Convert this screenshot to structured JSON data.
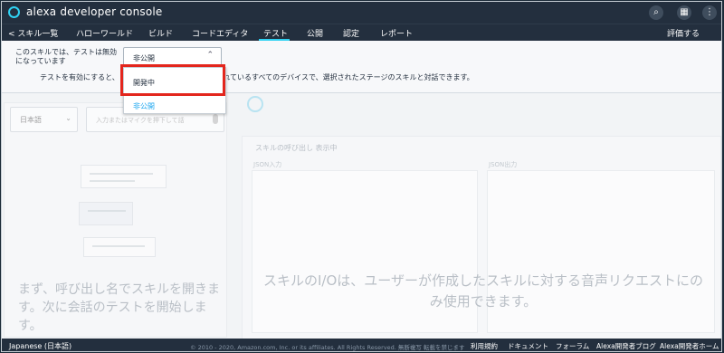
{
  "header": {
    "app_title": "alexa developer console",
    "icons": [
      "search-icon",
      "apps-icon",
      "more-vert-icon"
    ]
  },
  "nav": {
    "items": [
      "< スキル一覧",
      "ハローワールド",
      "ビルド",
      "コードエディタ",
      "テスト",
      "公開",
      "認定",
      "レポート"
    ],
    "active": "テスト",
    "right_item": "評価する"
  },
  "test_info": {
    "question": "このスキルでは、テストは無効になっています",
    "selected_stage": "非公開",
    "description": "テストを有効にすると、                   開発者アカウントに関連付けられているすべてのデバイスで、選択されたステージのスキルと対話できます。"
  },
  "dropdown": {
    "options": [
      "開発中",
      "非公開"
    ],
    "highlighted": "開発中",
    "selected": "非公開"
  },
  "left_panel": {
    "language": "日本語",
    "input_placeholder": "入力またはマイクを押下して話",
    "empty_message": "まず、呼び出し名でスキルを開きます。次に会話のテストを開始します。"
  },
  "right_panel": {
    "title": "スキルの呼び出し    表示中",
    "json_in_label": "JSON入力",
    "json_out_label": "JSON出力",
    "message": "スキルのI/Oは、ユーザーが作成したスキルに対する音声リクエストにのみ使用できます。"
  },
  "footer": {
    "language": "Japanese (日本語)",
    "copyright": "© 2010 - 2020, Amazon.com, Inc. or its affiliates. All Rights Reserved. 無断複写 転載を禁じます",
    "links": [
      "利用規約",
      "ドキュメント",
      "フォーラム",
      "Alexa開発者ブログ",
      "Alexa開発者ホーム"
    ]
  },
  "colors": {
    "topbar": "#232f3e",
    "accent": "#2fd1f2",
    "highlight_border": "#e3261d",
    "link_blue": "#1ea7f0"
  }
}
